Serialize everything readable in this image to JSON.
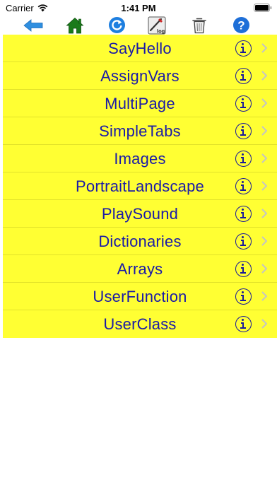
{
  "status_bar": {
    "carrier": "Carrier",
    "time": "1:41 PM"
  },
  "toolbar": {
    "buttons": [
      {
        "name": "back",
        "icon": "arrow-left-icon",
        "color": "#2f8fe0"
      },
      {
        "name": "home",
        "icon": "home-icon",
        "color": "#1a7a1a"
      },
      {
        "name": "refresh",
        "icon": "refresh-icon",
        "color": "#1e7fe0"
      },
      {
        "name": "log",
        "icon": "log-icon",
        "text": "log"
      },
      {
        "name": "delete",
        "icon": "trash-icon"
      },
      {
        "name": "help",
        "icon": "help-icon",
        "color": "#1e6fd8"
      }
    ]
  },
  "list": {
    "background": "#ffff33",
    "text_color": "#1a1aa8",
    "items": [
      {
        "label": "SayHello"
      },
      {
        "label": "AssignVars"
      },
      {
        "label": "MultiPage"
      },
      {
        "label": "SimpleTabs"
      },
      {
        "label": "Images"
      },
      {
        "label": "PortraitLandscape"
      },
      {
        "label": "PlaySound"
      },
      {
        "label": "Dictionaries"
      },
      {
        "label": "Arrays"
      },
      {
        "label": "UserFunction"
      },
      {
        "label": "UserClass"
      }
    ]
  }
}
